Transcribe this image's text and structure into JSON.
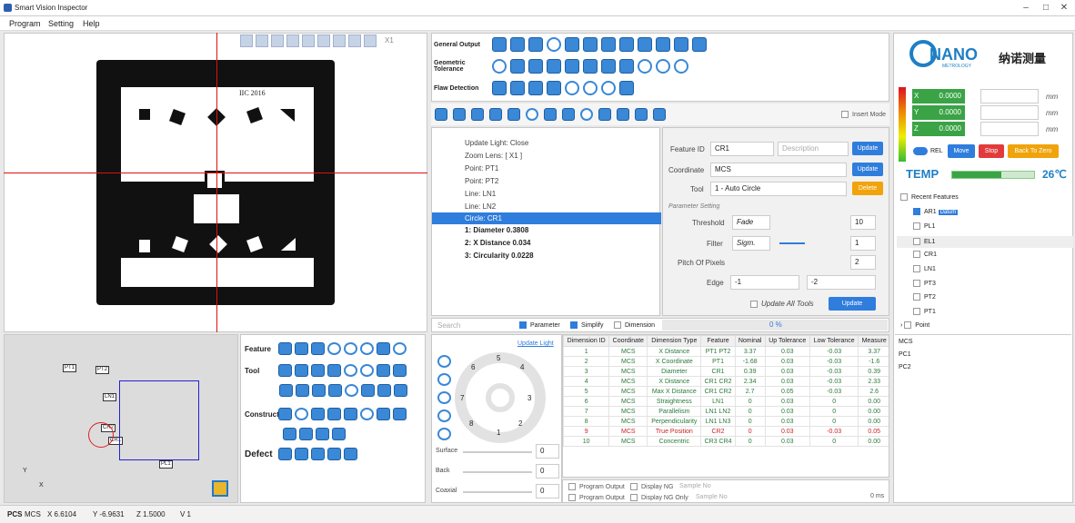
{
  "window": {
    "title": "Smart Vision Inspector"
  },
  "menu": [
    "Program",
    "Setting",
    "Help"
  ],
  "camera": {
    "zoom_label": "X1",
    "board_text": "IIC 2016"
  },
  "view3d": {
    "tags": [
      "PT1",
      "PT2",
      "LN1",
      "CR2",
      "CR1",
      "PL1"
    ],
    "axis_x": "X",
    "axis_y": "Y"
  },
  "tools": {
    "rows": [
      "Feature",
      "Tool",
      "Construct",
      "Defect"
    ]
  },
  "toolbars": {
    "general": "General Output",
    "geometric": "Geometric Tolerance",
    "flaw": "Flaw Detection",
    "insert_mode": "Insert Mode"
  },
  "program": {
    "steps": [
      "Update Light: Close",
      "Zoom Lens: [ X1 ]",
      "Point: PT1",
      "Point: PT2",
      "Line: LN1",
      "Line: LN2",
      "Circle: CR1"
    ],
    "results": [
      "1: Diameter  0.3808",
      "2: X Distance  0.034",
      "3: Circularity  0.0228"
    ]
  },
  "params": {
    "feature_id_label": "Feature ID",
    "feature_id": "CR1",
    "description_ph": "Description",
    "update": "Update",
    "coordinate_label": "Coordinate",
    "coordinate": "MCS",
    "tool_label": "Tool",
    "tool": "1 - Auto Circle",
    "delete": "Delete",
    "section": "Parameter Setting",
    "threshold_label": "Threshold",
    "threshold_mode": "Fade",
    "threshold_val": "10",
    "filter_label": "Filter",
    "filter_mode": "Sigm.",
    "filter_val": "1",
    "pitch_label": "Pitch Of Pixels",
    "pitch_val": "2",
    "edge_label": "Edge",
    "edge_a": "-1",
    "edge_b": "-2",
    "update_all": "Update All Tools"
  },
  "searchbar": {
    "search_ph": "Search",
    "parameter": "Parameter",
    "simplify": "Simplify",
    "dimension": "Dimension",
    "progress": "0 %"
  },
  "light": {
    "update_light": "Update Light",
    "dial_numbers": [
      "5",
      "4",
      "3",
      "2",
      "1",
      "8",
      "7",
      "6"
    ],
    "surface": "Surface",
    "back": "Back",
    "coaxial": "Coaxial",
    "surface_val": "0",
    "back_val": "0",
    "coaxial_val": "0"
  },
  "table": {
    "headers": [
      "Dimension ID",
      "Coordinate",
      "Dimension Type",
      "Feature",
      "Nominal",
      "Up Tolerance",
      "Low Tolerance",
      "Measure"
    ],
    "rows": [
      [
        "1",
        "MCS",
        "X Distance",
        "PT1  PT2",
        "3.37",
        "0.03",
        "-0.03",
        "3.37"
      ],
      [
        "2",
        "MCS",
        "X Coordinate",
        "PT1",
        "-1.68",
        "0.03",
        "-0.03",
        "-1.6"
      ],
      [
        "3",
        "MCS",
        "Diameter",
        "CR1",
        "0.39",
        "0.03",
        "-0.03",
        "0.39"
      ],
      [
        "4",
        "MCS",
        "X Distance",
        "CR1  CR2",
        "2.34",
        "0.03",
        "-0.03",
        "2.33"
      ],
      [
        "5",
        "MCS",
        "Max X Distance",
        "CR1  CR2",
        "2.7",
        "0.05",
        "-0.03",
        "2.6"
      ],
      [
        "6",
        "MCS",
        "Straightness",
        "LN1",
        "0",
        "0.03",
        "0",
        "0.00"
      ],
      [
        "7",
        "MCS",
        "Parallelism",
        "LN1  LN2",
        "0",
        "0.03",
        "0",
        "0.00"
      ],
      [
        "8",
        "MCS",
        "Perpendicularity",
        "LN1  LN3",
        "0",
        "0.03",
        "0",
        "0.00"
      ],
      [
        "9",
        "MCS",
        "True Position",
        "CR2",
        "0",
        "0.03",
        "-0.03",
        "0.05"
      ],
      [
        "10",
        "MCS",
        "Concentric",
        "CR3  CR4",
        "0",
        "0.03",
        "0",
        "0.00"
      ]
    ]
  },
  "output": {
    "program_output": "Program Output",
    "display_ng": "Display NG",
    "sample_no": "Sample No",
    "display_ng_only": "Display NG Only",
    "time": "0 ms"
  },
  "right": {
    "logo_text": "NANO",
    "logo_sub": "METROLOGY",
    "logo_cn": "纳诺测量",
    "axes": [
      {
        "name": "X",
        "val": "0.0000"
      },
      {
        "name": "Y",
        "val": "0.0000"
      },
      {
        "name": "Z",
        "val": "0.0000"
      }
    ],
    "unit": "mm",
    "rel": "REL",
    "move": "Move",
    "stop": "Stop",
    "back_zero": "Back To Zero",
    "temp_label": "TEMP",
    "temp_val": "26℃",
    "recent": "Recent Features",
    "datum": "Datum",
    "features": [
      "AR1",
      "PL1",
      "EL1",
      "CR1",
      "LN1",
      "PT3",
      "PT2",
      "PT1"
    ],
    "point": "Point",
    "coords": [
      "MCS",
      "PC1",
      "PC2"
    ]
  },
  "status": {
    "pcs_label": "PCS",
    "pcs": "MCS",
    "x": "X 6.6104",
    "y": "Y -6.9631",
    "z": "Z 1.5000",
    "v": "V 1"
  },
  "colors": {
    "accent": "#2f7ddc",
    "warn": "#f0a30a",
    "stop": "#e23b3b",
    "axis": "#3aa346"
  }
}
